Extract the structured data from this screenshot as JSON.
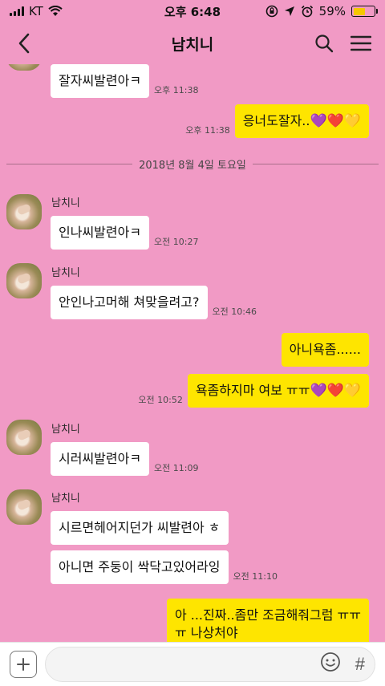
{
  "status_bar": {
    "carrier": "KT",
    "time": "오후 6:48",
    "battery_percent": "59%",
    "battery_level": 0.59
  },
  "header": {
    "title": "남치니"
  },
  "date_separator": "2018년 8월 4일 토요일",
  "messages": [
    {
      "sender": "남치니",
      "text": "잘자씨발련아ㅋ",
      "time": "오후 11:38"
    },
    {
      "sender": "me",
      "text": "응너도잘자..",
      "time": "오후 11:38"
    },
    {
      "sender": "남치니",
      "text": "인나씨발련아ㅋ",
      "time": "오전 10:27"
    },
    {
      "sender": "남치니",
      "text": "안인나고머해 쳐맞을려고?",
      "time": "오전 10:46"
    },
    {
      "sender": "me",
      "text": "아니욕좀......",
      "time": ""
    },
    {
      "sender": "me",
      "text": "욕좀하지마 여보 ㅠㅠ",
      "time": "오전 10:52"
    },
    {
      "sender": "남치니",
      "text": "시러씨발련아ㅋ",
      "time": "오전 11:09"
    },
    {
      "sender": "남치니",
      "text": "시르면헤어지던가 씨발련아 ㅎ",
      "time": ""
    },
    {
      "sender": "남치니",
      "text": "아니면 주둥이 싹닥고있어라잉",
      "time": "오전 11:10"
    },
    {
      "sender": "me",
      "text": "아 ...진짜..좀만 조금해줘그럼 ㅠㅠ",
      "time": ""
    },
    {
      "sender": "me",
      "text": "ㅠ 나상처야",
      "time": ""
    }
  ],
  "icons": {
    "back": "chevron-left-icon",
    "search": "search-icon",
    "menu": "hamburger-menu-icon",
    "attach": "plus-icon",
    "emoji": "emoji-icon",
    "hashtag": "hashtag-icon",
    "hearts": [
      "💜",
      "❤️",
      "💛"
    ]
  },
  "input": {
    "placeholder": "",
    "hashtag_label": "#"
  },
  "colors": {
    "chat_background": "#f19ac5",
    "outgoing_bubble": "#fee500",
    "incoming_bubble": "#ffffff"
  }
}
